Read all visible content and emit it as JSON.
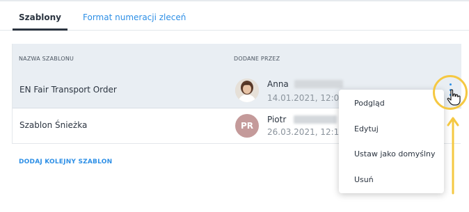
{
  "tabs": [
    {
      "label": "Szablony",
      "active": true
    },
    {
      "label": "Format numeracji zleceń",
      "active": false
    }
  ],
  "table": {
    "headers": {
      "name": "NAZWA SZABLONU",
      "added_by": "DODANE PRZEZ"
    },
    "rows": [
      {
        "name": "EN Fair Transport Order",
        "user_first_name": "Anna",
        "date": "14.01.2021, 12:00",
        "avatar": "photo"
      },
      {
        "name": "Szablon Śnieżka",
        "user_first_name": "Piotr",
        "date": "26.03.2021, 12:16",
        "avatar_initials": "PR",
        "avatar_color": "#c49a9a"
      }
    ]
  },
  "add_template_label": "DODAJ KOLEJNY SZABLON",
  "row_menu": {
    "trigger_icon": "kebab-vertical-icon",
    "items": [
      "Podgląd",
      "Edytuj",
      "Ustaw jako domyślny",
      "Usuń"
    ]
  },
  "annotation": {
    "highlight_color": "#f5c842"
  },
  "colors": {
    "accent": "#2d8fe6",
    "text": "#2b3440",
    "header_bg": "#e9eef3"
  }
}
